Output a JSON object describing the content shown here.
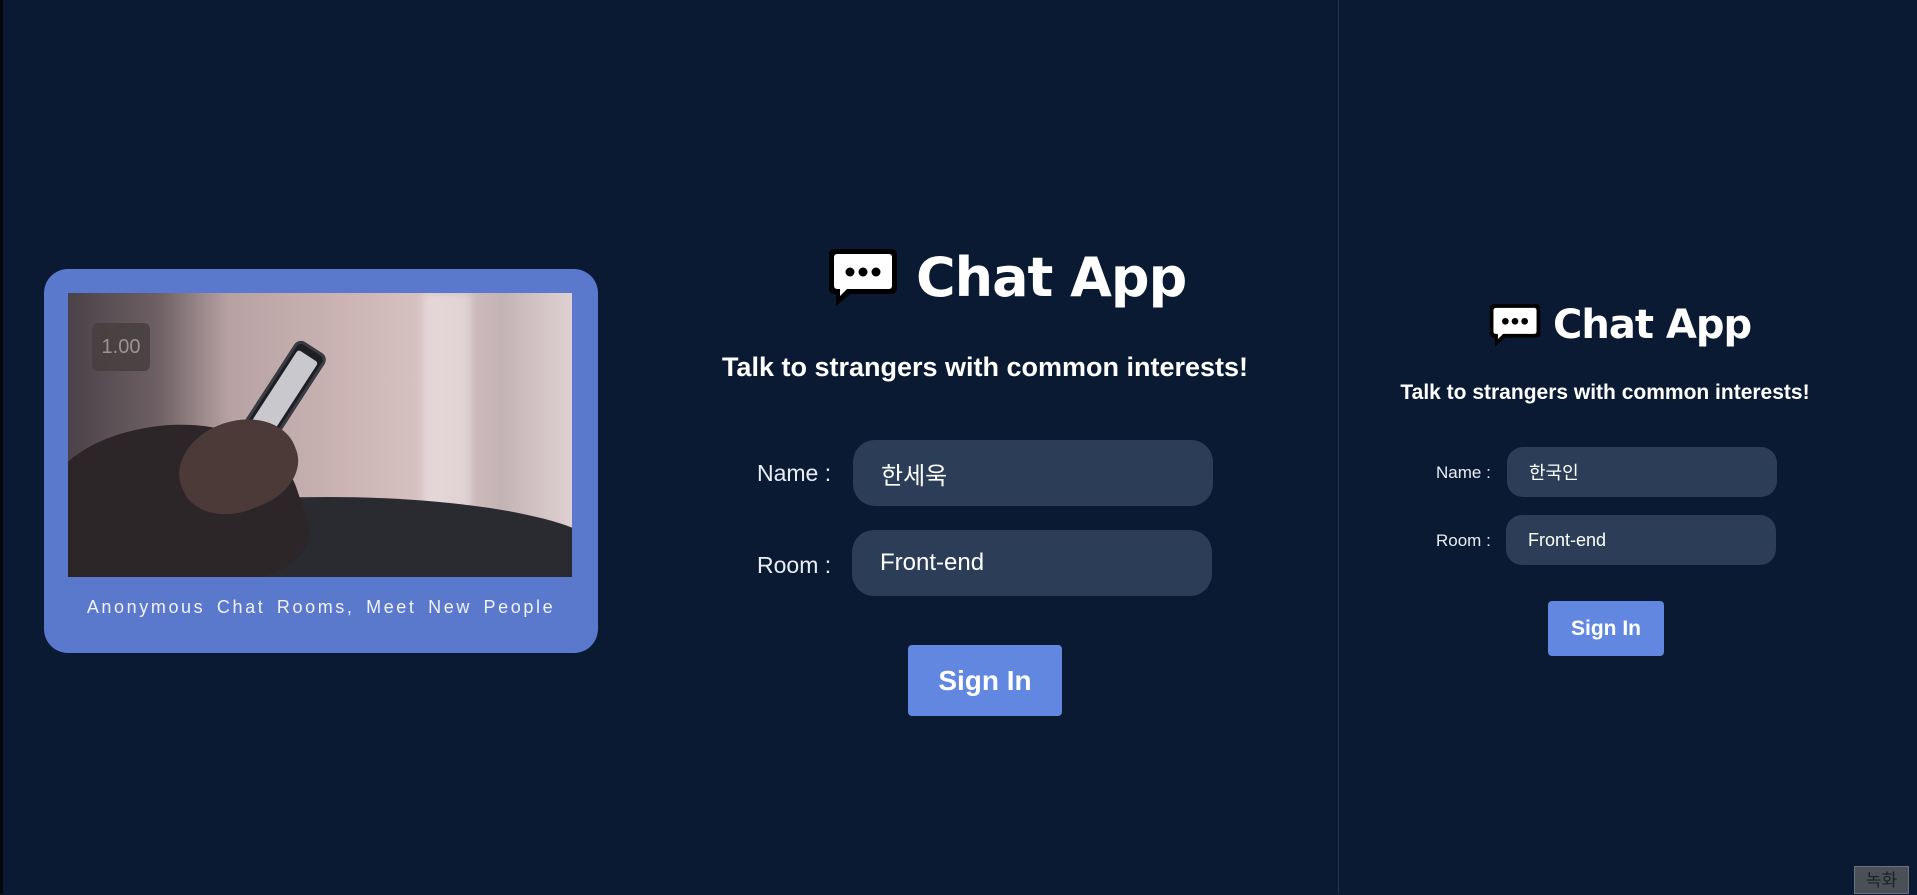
{
  "video": {
    "speed_label": "1.00",
    "caption": "Anonymous Chat Rooms, Meet New People"
  },
  "main_form": {
    "title": "Chat App",
    "subtitle": "Talk to strangers with common interests!",
    "name_label": "Name :",
    "name_value": "한세욱",
    "room_label": "Room :",
    "room_value": "Front-end",
    "signin_label": "Sign In"
  },
  "side_form": {
    "title": "Chat App",
    "subtitle": "Talk to strangers with common interests!",
    "name_label": "Name :",
    "name_value": "한국인",
    "room_label": "Room :",
    "room_value": "Front-end",
    "signin_label": "Sign In"
  },
  "record_button_label": "녹화",
  "colors": {
    "background": "#0b1a33",
    "card": "#5b79cc",
    "input": "#2c3d58",
    "button": "#6287e0"
  },
  "icons": [
    "chat-bubble-icon"
  ]
}
